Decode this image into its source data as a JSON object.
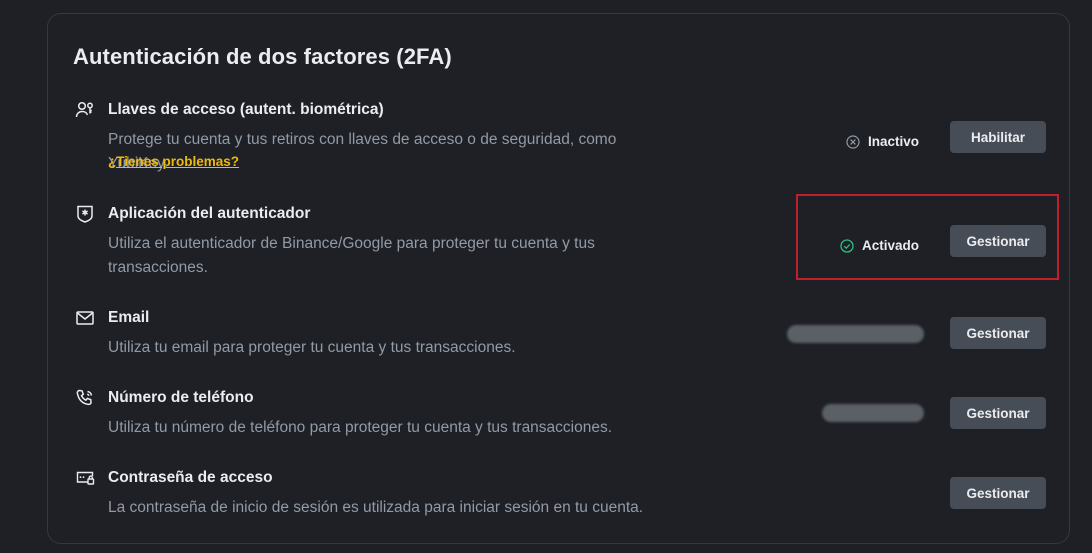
{
  "section": {
    "title": "Autenticación de dos factores (2FA)"
  },
  "rows": [
    {
      "icon": "user-key-icon",
      "name": "Llaves de acceso (autent. biométrica)",
      "description": "Protege tu cuenta y tus retiros con llaves de acceso o de seguridad, como YubiKey.",
      "link": "¿Tienes problemas?",
      "status": "Inactivo",
      "button": "Habilitar"
    },
    {
      "icon": "authenticator-shield-icon",
      "name": "Aplicación del autenticador",
      "description": "Utiliza el autenticador de Binance/Google para proteger tu cuenta y tus transacciones.",
      "status": "Activado",
      "button": "Gestionar"
    },
    {
      "icon": "mail-icon",
      "name": "Email",
      "description": "Utiliza tu email para proteger tu cuenta y tus transacciones.",
      "button": "Gestionar"
    },
    {
      "icon": "phone-icon",
      "name": "Número de teléfono",
      "description": "Utiliza tu número de teléfono para proteger tu cuenta y tus transacciones.",
      "button": "Gestionar"
    },
    {
      "icon": "password-icon",
      "name": "Contraseña de acceso",
      "description": "La contraseña de inicio de sesión es utilizada para iniciar sesión en tu cuenta.",
      "button": "Gestionar"
    }
  ],
  "colors": {
    "background": "#1e2026",
    "button": "#474d57",
    "link": "#f0b90b",
    "success": "#2ebd85",
    "highlight": "#c0202a"
  }
}
